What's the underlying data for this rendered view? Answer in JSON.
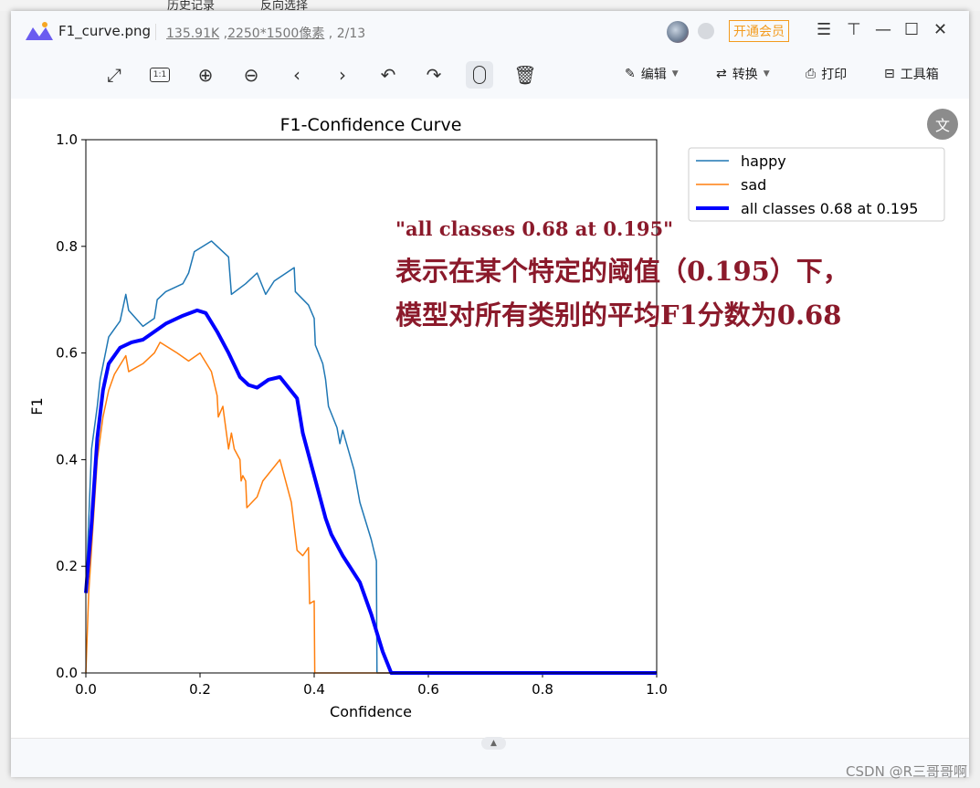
{
  "background": {
    "tab1": "历史记录",
    "tab2": "反向选择"
  },
  "titlebar": {
    "filename": "F1_curve.png",
    "filesize": "135.91K",
    "dimensions": "2250*1500像素",
    "page": "2/13",
    "vip_label": "开通会员"
  },
  "toolbar": {
    "edit": "编辑",
    "convert": "转换",
    "print": "打印",
    "toolbox": "工具箱"
  },
  "annotation": {
    "line1": "\"all classes 0.68 at 0.195\"",
    "line2": "表示在某个特定的阈值（0.195）下，",
    "line3": "模型对所有类别的平均F1分数为0.68"
  },
  "watermark": "CSDN @R三哥哥啊",
  "chart_data": {
    "type": "line",
    "title": "F1-Confidence Curve",
    "xlabel": "Confidence",
    "ylabel": "F1",
    "xlim": [
      0,
      1
    ],
    "ylim": [
      0,
      1
    ],
    "xticks": [
      "0.0",
      "0.2",
      "0.4",
      "0.6",
      "0.8",
      "1.0"
    ],
    "yticks": [
      "0.0",
      "0.2",
      "0.4",
      "0.6",
      "0.8",
      "1.0"
    ],
    "grid": false,
    "legend": "top-right",
    "series": [
      {
        "name": "happy",
        "color": "#1f77b4",
        "points": [
          [
            0,
            0.15
          ],
          [
            0.01,
            0.42
          ],
          [
            0.02,
            0.5
          ],
          [
            0.025,
            0.55
          ],
          [
            0.04,
            0.63
          ],
          [
            0.06,
            0.66
          ],
          [
            0.07,
            0.71
          ],
          [
            0.075,
            0.68
          ],
          [
            0.1,
            0.65
          ],
          [
            0.12,
            0.665
          ],
          [
            0.125,
            0.7
          ],
          [
            0.14,
            0.715
          ],
          [
            0.17,
            0.73
          ],
          [
            0.18,
            0.75
          ],
          [
            0.19,
            0.79
          ],
          [
            0.22,
            0.81
          ],
          [
            0.25,
            0.78
          ],
          [
            0.255,
            0.71
          ],
          [
            0.28,
            0.73
          ],
          [
            0.3,
            0.75
          ],
          [
            0.315,
            0.71
          ],
          [
            0.33,
            0.735
          ],
          [
            0.365,
            0.76
          ],
          [
            0.367,
            0.715
          ],
          [
            0.39,
            0.69
          ],
          [
            0.4,
            0.665
          ],
          [
            0.402,
            0.615
          ],
          [
            0.415,
            0.58
          ],
          [
            0.42,
            0.55
          ],
          [
            0.425,
            0.5
          ],
          [
            0.44,
            0.46
          ],
          [
            0.445,
            0.43
          ],
          [
            0.45,
            0.455
          ],
          [
            0.47,
            0.38
          ],
          [
            0.48,
            0.32
          ],
          [
            0.5,
            0.25
          ],
          [
            0.509,
            0.21
          ],
          [
            0.51,
            0
          ],
          [
            1,
            0
          ]
        ]
      },
      {
        "name": "sad",
        "color": "#ff7f0e",
        "points": [
          [
            0,
            0
          ],
          [
            0.005,
            0.15
          ],
          [
            0.02,
            0.4
          ],
          [
            0.03,
            0.48
          ],
          [
            0.04,
            0.53
          ],
          [
            0.05,
            0.56
          ],
          [
            0.07,
            0.595
          ],
          [
            0.075,
            0.565
          ],
          [
            0.1,
            0.58
          ],
          [
            0.12,
            0.6
          ],
          [
            0.13,
            0.62
          ],
          [
            0.16,
            0.6
          ],
          [
            0.18,
            0.585
          ],
          [
            0.2,
            0.6
          ],
          [
            0.22,
            0.565
          ],
          [
            0.23,
            0.52
          ],
          [
            0.232,
            0.48
          ],
          [
            0.24,
            0.5
          ],
          [
            0.245,
            0.46
          ],
          [
            0.25,
            0.42
          ],
          [
            0.255,
            0.45
          ],
          [
            0.26,
            0.42
          ],
          [
            0.27,
            0.4
          ],
          [
            0.272,
            0.36
          ],
          [
            0.275,
            0.37
          ],
          [
            0.28,
            0.36
          ],
          [
            0.282,
            0.31
          ],
          [
            0.3,
            0.33
          ],
          [
            0.31,
            0.36
          ],
          [
            0.34,
            0.4
          ],
          [
            0.36,
            0.32
          ],
          [
            0.37,
            0.23
          ],
          [
            0.38,
            0.22
          ],
          [
            0.39,
            0.235
          ],
          [
            0.392,
            0.13
          ],
          [
            0.4,
            0.135
          ],
          [
            0.401,
            0
          ],
          [
            1,
            0
          ]
        ]
      },
      {
        "name": "all classes 0.68 at 0.195",
        "color": "#0000ff",
        "points": [
          [
            0,
            0.15
          ],
          [
            0.01,
            0.28
          ],
          [
            0.02,
            0.44
          ],
          [
            0.03,
            0.53
          ],
          [
            0.04,
            0.58
          ],
          [
            0.06,
            0.61
          ],
          [
            0.08,
            0.62
          ],
          [
            0.1,
            0.625
          ],
          [
            0.12,
            0.64
          ],
          [
            0.14,
            0.655
          ],
          [
            0.17,
            0.67
          ],
          [
            0.195,
            0.68
          ],
          [
            0.21,
            0.675
          ],
          [
            0.23,
            0.64
          ],
          [
            0.25,
            0.6
          ],
          [
            0.27,
            0.555
          ],
          [
            0.285,
            0.54
          ],
          [
            0.3,
            0.535
          ],
          [
            0.32,
            0.55
          ],
          [
            0.34,
            0.555
          ],
          [
            0.37,
            0.515
          ],
          [
            0.38,
            0.45
          ],
          [
            0.4,
            0.37
          ],
          [
            0.42,
            0.29
          ],
          [
            0.43,
            0.26
          ],
          [
            0.45,
            0.22
          ],
          [
            0.48,
            0.17
          ],
          [
            0.5,
            0.11
          ],
          [
            0.52,
            0.04
          ],
          [
            0.535,
            0
          ],
          [
            1,
            0
          ]
        ]
      }
    ]
  }
}
